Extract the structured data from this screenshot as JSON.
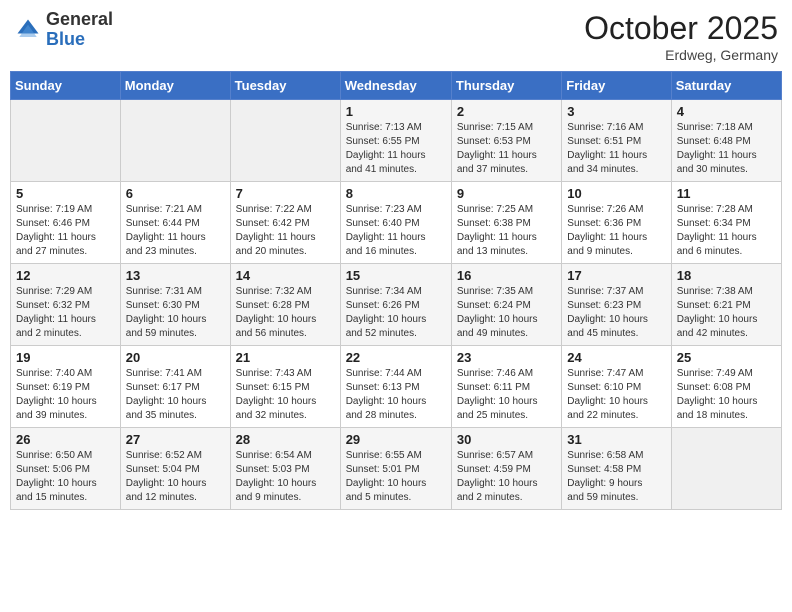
{
  "header": {
    "logo_general": "General",
    "logo_blue": "Blue",
    "month_title": "October 2025",
    "location": "Erdweg, Germany"
  },
  "days_of_week": [
    "Sunday",
    "Monday",
    "Tuesday",
    "Wednesday",
    "Thursday",
    "Friday",
    "Saturday"
  ],
  "weeks": [
    [
      {
        "day": "",
        "info": ""
      },
      {
        "day": "",
        "info": ""
      },
      {
        "day": "",
        "info": ""
      },
      {
        "day": "1",
        "info": "Sunrise: 7:13 AM\nSunset: 6:55 PM\nDaylight: 11 hours\nand 41 minutes."
      },
      {
        "day": "2",
        "info": "Sunrise: 7:15 AM\nSunset: 6:53 PM\nDaylight: 11 hours\nand 37 minutes."
      },
      {
        "day": "3",
        "info": "Sunrise: 7:16 AM\nSunset: 6:51 PM\nDaylight: 11 hours\nand 34 minutes."
      },
      {
        "day": "4",
        "info": "Sunrise: 7:18 AM\nSunset: 6:48 PM\nDaylight: 11 hours\nand 30 minutes."
      }
    ],
    [
      {
        "day": "5",
        "info": "Sunrise: 7:19 AM\nSunset: 6:46 PM\nDaylight: 11 hours\nand 27 minutes."
      },
      {
        "day": "6",
        "info": "Sunrise: 7:21 AM\nSunset: 6:44 PM\nDaylight: 11 hours\nand 23 minutes."
      },
      {
        "day": "7",
        "info": "Sunrise: 7:22 AM\nSunset: 6:42 PM\nDaylight: 11 hours\nand 20 minutes."
      },
      {
        "day": "8",
        "info": "Sunrise: 7:23 AM\nSunset: 6:40 PM\nDaylight: 11 hours\nand 16 minutes."
      },
      {
        "day": "9",
        "info": "Sunrise: 7:25 AM\nSunset: 6:38 PM\nDaylight: 11 hours\nand 13 minutes."
      },
      {
        "day": "10",
        "info": "Sunrise: 7:26 AM\nSunset: 6:36 PM\nDaylight: 11 hours\nand 9 minutes."
      },
      {
        "day": "11",
        "info": "Sunrise: 7:28 AM\nSunset: 6:34 PM\nDaylight: 11 hours\nand 6 minutes."
      }
    ],
    [
      {
        "day": "12",
        "info": "Sunrise: 7:29 AM\nSunset: 6:32 PM\nDaylight: 11 hours\nand 2 minutes."
      },
      {
        "day": "13",
        "info": "Sunrise: 7:31 AM\nSunset: 6:30 PM\nDaylight: 10 hours\nand 59 minutes."
      },
      {
        "day": "14",
        "info": "Sunrise: 7:32 AM\nSunset: 6:28 PM\nDaylight: 10 hours\nand 56 minutes."
      },
      {
        "day": "15",
        "info": "Sunrise: 7:34 AM\nSunset: 6:26 PM\nDaylight: 10 hours\nand 52 minutes."
      },
      {
        "day": "16",
        "info": "Sunrise: 7:35 AM\nSunset: 6:24 PM\nDaylight: 10 hours\nand 49 minutes."
      },
      {
        "day": "17",
        "info": "Sunrise: 7:37 AM\nSunset: 6:23 PM\nDaylight: 10 hours\nand 45 minutes."
      },
      {
        "day": "18",
        "info": "Sunrise: 7:38 AM\nSunset: 6:21 PM\nDaylight: 10 hours\nand 42 minutes."
      }
    ],
    [
      {
        "day": "19",
        "info": "Sunrise: 7:40 AM\nSunset: 6:19 PM\nDaylight: 10 hours\nand 39 minutes."
      },
      {
        "day": "20",
        "info": "Sunrise: 7:41 AM\nSunset: 6:17 PM\nDaylight: 10 hours\nand 35 minutes."
      },
      {
        "day": "21",
        "info": "Sunrise: 7:43 AM\nSunset: 6:15 PM\nDaylight: 10 hours\nand 32 minutes."
      },
      {
        "day": "22",
        "info": "Sunrise: 7:44 AM\nSunset: 6:13 PM\nDaylight: 10 hours\nand 28 minutes."
      },
      {
        "day": "23",
        "info": "Sunrise: 7:46 AM\nSunset: 6:11 PM\nDaylight: 10 hours\nand 25 minutes."
      },
      {
        "day": "24",
        "info": "Sunrise: 7:47 AM\nSunset: 6:10 PM\nDaylight: 10 hours\nand 22 minutes."
      },
      {
        "day": "25",
        "info": "Sunrise: 7:49 AM\nSunset: 6:08 PM\nDaylight: 10 hours\nand 18 minutes."
      }
    ],
    [
      {
        "day": "26",
        "info": "Sunrise: 6:50 AM\nSunset: 5:06 PM\nDaylight: 10 hours\nand 15 minutes."
      },
      {
        "day": "27",
        "info": "Sunrise: 6:52 AM\nSunset: 5:04 PM\nDaylight: 10 hours\nand 12 minutes."
      },
      {
        "day": "28",
        "info": "Sunrise: 6:54 AM\nSunset: 5:03 PM\nDaylight: 10 hours\nand 9 minutes."
      },
      {
        "day": "29",
        "info": "Sunrise: 6:55 AM\nSunset: 5:01 PM\nDaylight: 10 hours\nand 5 minutes."
      },
      {
        "day": "30",
        "info": "Sunrise: 6:57 AM\nSunset: 4:59 PM\nDaylight: 10 hours\nand 2 minutes."
      },
      {
        "day": "31",
        "info": "Sunrise: 6:58 AM\nSunset: 4:58 PM\nDaylight: 9 hours\nand 59 minutes."
      },
      {
        "day": "",
        "info": ""
      }
    ]
  ]
}
